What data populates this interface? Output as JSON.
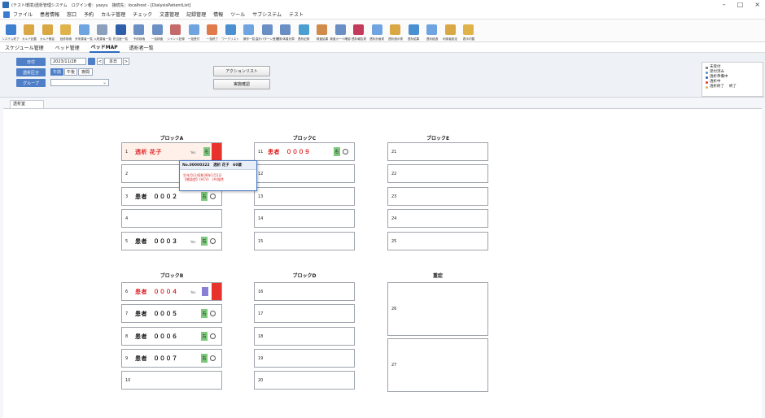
{
  "window": {
    "title": "(テスト環境)透析管理システム　ログイン者：yasyu　接続先：localhost - [DialysisPatientList]",
    "controls": [
      "–",
      "□",
      "×"
    ]
  },
  "menu": [
    "ファイル",
    "患者情報",
    "窓口",
    "予約",
    "カルテ管理",
    "チェック",
    "文書管理",
    "記録管理",
    "情報",
    "ツール",
    "サブシステム",
    "テスト"
  ],
  "toolbar": [
    {
      "label": "システム終了",
      "color": "#3f7fd0"
    },
    {
      "label": "カルテ記載",
      "color": "#d9a844"
    },
    {
      "label": "カルテ照会",
      "color": "#d9a844"
    },
    {
      "label": "回診検索",
      "color": "#e0b34a"
    },
    {
      "label": "外来患者一覧",
      "color": "#6fa4e0"
    },
    {
      "label": "入院患者一覧",
      "color": "#8aa0bc"
    },
    {
      "label": "担当医一覧",
      "color": "#2e5fa8"
    },
    {
      "label": "予約検索",
      "color": "#6a8fc4"
    },
    {
      "label": "一括検査",
      "color": "#6a8fc4"
    },
    {
      "label": "シャント記録",
      "color": "#c46a6a"
    },
    {
      "label": "一括受付",
      "color": "#6fa4e0"
    },
    {
      "label": "一括終了",
      "color": "#e07a4a"
    },
    {
      "label": "ワークリスト",
      "color": "#4a8fd0"
    },
    {
      "label": "操作一覧",
      "color": "#6fa4e0"
    },
    {
      "label": "温計パターン登録",
      "color": "#6a8fc4"
    },
    {
      "label": "透析体重計算",
      "color": "#6a8fc4"
    },
    {
      "label": "透析記録",
      "color": "#4a9fd0"
    },
    {
      "label": "検査結果",
      "color": "#d08a4a"
    },
    {
      "label": "検査カード確認",
      "color": "#6a8fc4"
    },
    {
      "label": "透析報告書",
      "color": "#c43a5a"
    },
    {
      "label": "透析計画書",
      "color": "#6fa4e0"
    },
    {
      "label": "透析指示書",
      "color": "#d9a844"
    },
    {
      "label": "透析結果",
      "color": "#4a8fd0"
    },
    {
      "label": "透析経過",
      "color": "#6fa4e0"
    },
    {
      "label": "利用者設定",
      "color": "#d9a844"
    },
    {
      "label": "表示切替",
      "color": "#e0b34a"
    }
  ],
  "nav": [
    "スケジュール管理",
    "ベッド管理",
    "ベッドMAP",
    "透析者一覧"
  ],
  "nav_active": 2,
  "controls": {
    "btn_day": "日付",
    "btn_session": "透析区分",
    "btn_group": "グループ",
    "date": "2023/11/28",
    "prev": "<",
    "today": "本日",
    "next": ">",
    "am": "午前",
    "pm": "午後",
    "night": "夜間",
    "action_list": "アクションリスト",
    "real_time": "実施確認"
  },
  "legend": [
    {
      "label": "未受付",
      "color": "#ffffff",
      "border": "#555"
    },
    {
      "label": "受付済み",
      "color": "#4a8fd0",
      "border": "#4a8fd0"
    },
    {
      "label": "透析準備中",
      "color": "#2e5fa8",
      "border": "#2e5fa8"
    },
    {
      "label": "透析中",
      "color": "#e8322c",
      "border": "#e8322c"
    },
    {
      "label": "透析終了",
      "color": "#e0b34a",
      "border": "#e0b34a"
    }
  ],
  "legend_extra": "終了",
  "tab_label": "透析室",
  "blocks": {
    "a": "ブロックA",
    "b": "ブロックB",
    "c": "ブロックC",
    "d": "ブロックD",
    "e": "ブロックE",
    "other": "重症"
  },
  "beds": {
    "b1": {
      "num": "1",
      "name": "透析 花子",
      "tag": "Yes",
      "mark": "右"
    },
    "b2": {
      "num": "2"
    },
    "b3": {
      "num": "3",
      "name": "患者　０００２",
      "mark": "右"
    },
    "b4": {
      "num": "4"
    },
    "b5": {
      "num": "5",
      "name": "患者　０００３",
      "tag": "Yes",
      "mark": "右"
    },
    "b6": {
      "num": "6",
      "name": "患者　０００４",
      "tag": "Yes"
    },
    "b7": {
      "num": "7",
      "name": "患者　０００５",
      "mark": "右"
    },
    "b8": {
      "num": "8",
      "name": "患者　０００６",
      "mark": "右"
    },
    "b9": {
      "num": "9",
      "name": "患者　０００７",
      "mark": "右"
    },
    "b10": {
      "num": "10"
    },
    "b11": {
      "num": "11",
      "name": "患者　０００９",
      "mark": "右"
    },
    "b12": {
      "num": "12"
    },
    "b13": {
      "num": "13"
    },
    "b14": {
      "num": "14"
    },
    "b15": {
      "num": "15"
    },
    "b16": {
      "num": "16"
    },
    "b17": {
      "num": "17"
    },
    "b18": {
      "num": "18"
    },
    "b19": {
      "num": "19"
    },
    "b20": {
      "num": "20"
    },
    "b21": {
      "num": "21"
    },
    "b22": {
      "num": "22"
    },
    "b23": {
      "num": "23"
    },
    "b24": {
      "num": "24"
    },
    "b25": {
      "num": "25"
    },
    "b26": {
      "num": "26"
    },
    "b27": {
      "num": "27"
    }
  },
  "popup": {
    "header": "No.00000322　透析 花子　60歳",
    "line1": "生年月日:昭和38年1月1日",
    "line2": "【感染症】(HCV)　(※)陰性"
  }
}
